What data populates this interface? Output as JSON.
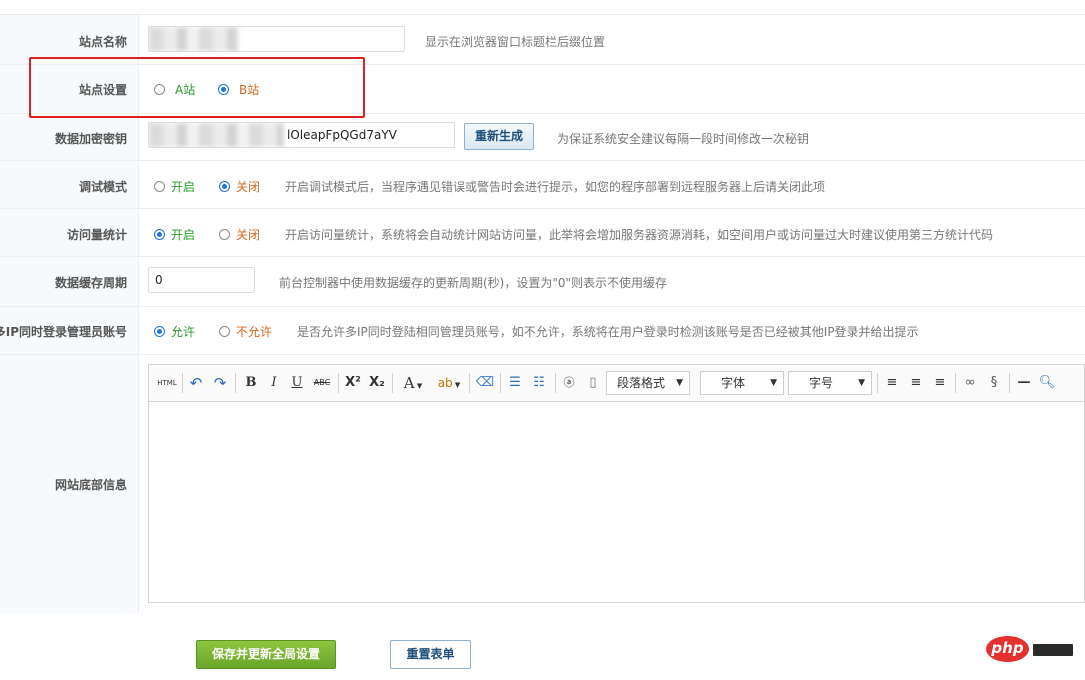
{
  "form": {
    "site_name": {
      "label": "站点名称",
      "value": "",
      "hint": "显示在浏览器窗口标题栏后缀位置"
    },
    "site_setting": {
      "label": "站点设置",
      "options": [
        "A站",
        "B站"
      ],
      "selected": "B站"
    },
    "encrypt_key": {
      "label": "数据加密密钥",
      "value_visible": "lOleapFpQGd7aYV",
      "regen_button": "重新生成",
      "hint": "为保证系统安全建议每隔一段时间修改一次秘钥"
    },
    "debug_mode": {
      "label": "调试模式",
      "options": [
        "开启",
        "关闭"
      ],
      "selected": "关闭",
      "hint": "开启调试模式后，当程序遇见错误或警告时会进行提示，如您的程序部署到远程服务器上后请关闭此项"
    },
    "visit_stats": {
      "label": "访问量统计",
      "options": [
        "开启",
        "关闭"
      ],
      "selected": "开启",
      "hint": "开启访问量统计，系统将会自动统计网站访问量，此举将会增加服务器资源消耗，如空间用户或访问量过大时建议使用第三方统计代码"
    },
    "cache_period": {
      "label": "数据缓存周期",
      "value": "0",
      "hint": "前台控制器中使用数据缓存的更新周期(秒)，设置为\"0\"则表示不使用缓存"
    },
    "multi_ip_login": {
      "label": "多IP同时登录管理员账号",
      "options": [
        "允许",
        "不允许"
      ],
      "selected": "允许",
      "hint": "是否允许多IP同时登陆相同管理员账号，如不允许，系统将在用户登录时检测该账号是否已经被其他IP登录并给出提示"
    },
    "footer_info": {
      "label": "网站底部信息"
    }
  },
  "editor": {
    "html_label": "HTML",
    "paragraph_select": "段落格式",
    "font_select": "字体",
    "size_select": "字号",
    "bold": "B",
    "italic": "I",
    "underline": "U",
    "strike": "ABC",
    "sup": "X²",
    "sub": "X₂",
    "fontcolor": "A"
  },
  "buttons": {
    "save": "保存并更新全局设置",
    "reset": "重置表单"
  },
  "watermark": {
    "logo": "php"
  },
  "colors": {
    "accent": "#1e73e6",
    "green": "#2a9a2a",
    "orange": "#d2691e",
    "save_bg": "#7bb536",
    "highlight_box": "#e02020"
  }
}
